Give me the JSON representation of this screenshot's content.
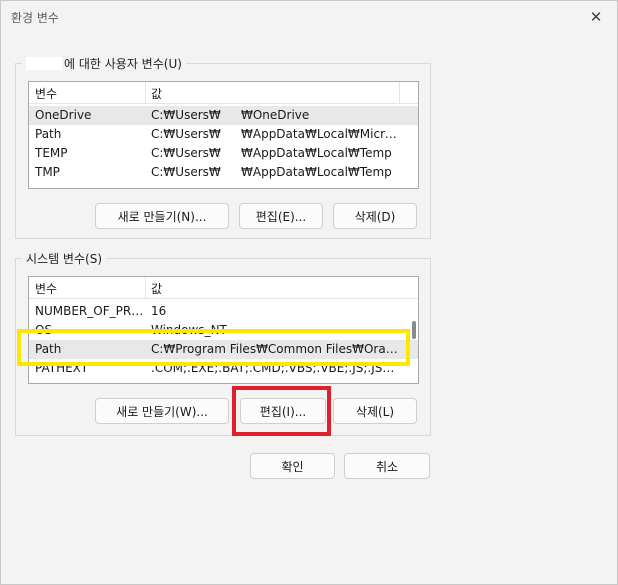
{
  "window": {
    "title": "환경 변수",
    "close_glyph": "✕"
  },
  "user_vars": {
    "group_label": "에 대한 사용자 변수(U)",
    "header": {
      "name": "변수",
      "value": "값"
    },
    "rows": [
      {
        "name": "OneDrive",
        "value_a": "C:₩Users₩",
        "value_b": "₩OneDrive"
      },
      {
        "name": "Path",
        "value_a": "C:₩Users₩",
        "value_b": "₩AppData₩Local₩Microsof..."
      },
      {
        "name": "TEMP",
        "value_a": "C:₩Users₩",
        "value_b": "₩AppData₩Local₩Temp"
      },
      {
        "name": "TMP",
        "value_a": "C:₩Users₩",
        "value_b": "₩AppData₩Local₩Temp"
      }
    ],
    "buttons": {
      "new": "새로 만들기(N)...",
      "edit": "편집(E)...",
      "delete": "삭제(D)"
    }
  },
  "system_vars": {
    "group_label": "시스템 변수(S)",
    "header": {
      "name": "변수",
      "value": "값"
    },
    "rows": [
      {
        "name": "NUMBER_OF_PRO...",
        "value": "16"
      },
      {
        "name": "OS",
        "value": "Windows_NT"
      },
      {
        "name": "Path",
        "value": "C:₩Program Files₩Common Files₩Oracle₩..."
      },
      {
        "name": "PATHEXT",
        "value": ".COM;.EXE;.BAT;.CMD;.VBS;.VBE;.JS;.JSE;.W..."
      }
    ],
    "buttons": {
      "new": "새로 만들기(W)...",
      "edit": "편집(I)...",
      "delete": "삭제(L)"
    }
  },
  "footer": {
    "ok": "확인",
    "cancel": "취소"
  },
  "colors": {
    "highlight_yellow": "#ffe600",
    "highlight_red": "#e0202a"
  }
}
